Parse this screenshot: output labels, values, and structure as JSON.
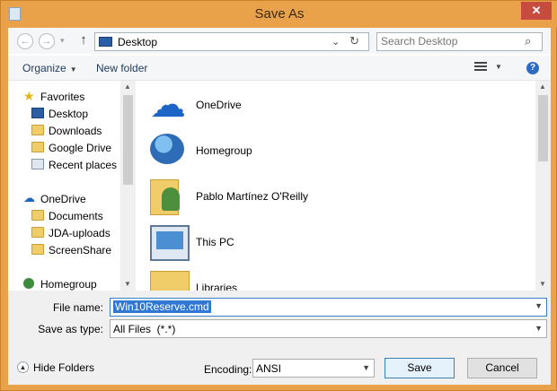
{
  "window": {
    "title": "Save As"
  },
  "address_bar": {
    "location": "Desktop",
    "search_placeholder": "Search Desktop"
  },
  "toolbar": {
    "organize": "Organize",
    "new_folder": "New folder"
  },
  "nav_pane": {
    "items": [
      {
        "label": "Favorites",
        "icon": "star-icon"
      },
      {
        "label": "Desktop",
        "icon": "desktop-icon"
      },
      {
        "label": "Downloads",
        "icon": "folder-icon"
      },
      {
        "label": "Google Drive",
        "icon": "folder-icon"
      },
      {
        "label": "Recent places",
        "icon": "recent-places-icon"
      },
      {
        "label": "OneDrive",
        "icon": "cloud-icon"
      },
      {
        "label": "Documents",
        "icon": "folder-icon"
      },
      {
        "label": "JDA-uploads",
        "icon": "folder-icon"
      },
      {
        "label": "ScreenShare",
        "icon": "folder-icon"
      },
      {
        "label": "Homegroup",
        "icon": "homegroup-icon"
      }
    ]
  },
  "file_list": {
    "items": [
      {
        "label": "OneDrive",
        "icon": "onedrive-icon"
      },
      {
        "label": "Homegroup",
        "icon": "homegroup-icon"
      },
      {
        "label": "Pablo Martínez O'Reilly",
        "icon": "user-folder-icon"
      },
      {
        "label": "This PC",
        "icon": "computer-icon"
      },
      {
        "label": "Libraries",
        "icon": "libraries-icon"
      }
    ]
  },
  "form": {
    "file_name_label": "File name:",
    "file_name_value": "Win10Reserve.cmd",
    "save_as_type_label": "Save as type:",
    "save_as_type_value": "All Files  (*.*)",
    "hide_folders": "Hide Folders",
    "encoding_label": "Encoding:",
    "encoding_value": "ANSI",
    "save_button": "Save",
    "cancel_button": "Cancel"
  },
  "colors": {
    "title_bar": "#e9a24a",
    "close_button": "#c74b3e",
    "selection": "#3178d4"
  }
}
